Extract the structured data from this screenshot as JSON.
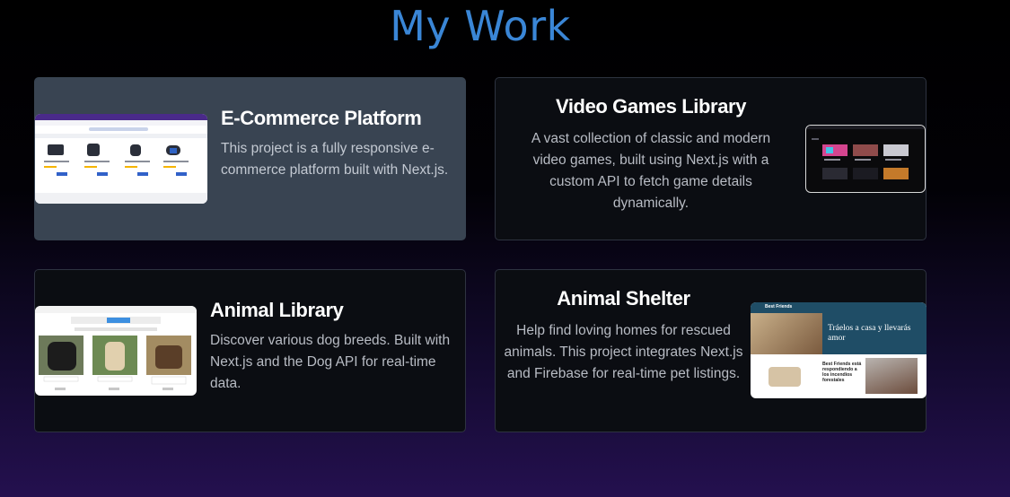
{
  "page": {
    "title": "My Work"
  },
  "projects": [
    {
      "title": "E-Commerce Platform",
      "description": "This project is a fully responsive e-commerce platform built with Next.js.",
      "thumb_icon": "ecommerce-screenshot"
    },
    {
      "title": "Video Games Library",
      "description": "A vast collection of classic and modern video games, built using Next.js with a custom API to fetch game details dynamically.",
      "thumb_icon": "games-screenshot"
    },
    {
      "title": "Animal Library",
      "description": "Discover various dog breeds. Built with Next.js and the Dog API for real-time data.",
      "thumb_icon": "dogs-screenshot"
    },
    {
      "title": "Animal Shelter",
      "description": "Help find loving homes for rescued animals. This project integrates Next.js and Firebase for real-time pet listings.",
      "thumb_icon": "shelter-screenshot"
    }
  ],
  "shelter_thumb": {
    "brand": "Best Friends",
    "headline": "Tráelos a casa y llevarás amor",
    "subheadline": "Best Friends está respondiendo a los incendios forestales"
  },
  "colors": {
    "accent": "#3a86d6",
    "card_active": "#394452",
    "card_bg": "#0b0d12",
    "border": "#2e3340"
  }
}
